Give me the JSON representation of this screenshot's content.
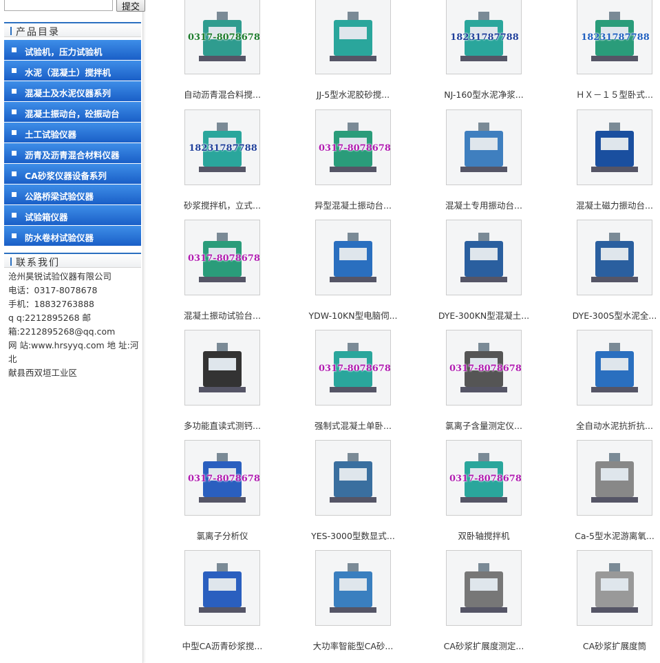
{
  "search": {
    "placeholder": "",
    "value": "",
    "submit_label": "提交"
  },
  "categories_title": "产品目录",
  "categories": [
    "试验机，压力试验机",
    "水泥（混凝土）搅拌机",
    "混凝土及水泥仪器系列",
    "混凝土振动台，砼振动台",
    "土工试验仪器",
    "沥青及沥青混合材料仪器",
    "CA砂浆仪器设备系列",
    "公路桥梁试验仪器",
    "试验箱仪器",
    "防水卷材试验仪器"
  ],
  "contact_title": "联系我们",
  "contact_lines": [
    "沧州昊锐试验仪器有限公司",
    "电话：0317-8078678",
    "手机：18832763888",
    "q q:2212895268 邮",
    "箱:2212895268@qq.com",
    "网 站:www.hrsyyq.com 地 址:河北",
    "献县西双垣工业区"
  ],
  "products": [
    {
      "caption": "自动沥青混合料搅...",
      "overlay": "0317-8078678",
      "overlay_color": "#1a7a2a",
      "accent": "#2f9c8f"
    },
    {
      "caption": "JJ-5型水泥胶砂搅...",
      "overlay": "",
      "overlay_color": "#1a7a2a",
      "accent": "#2aa69c"
    },
    {
      "caption": "NJ-160型水泥净浆...",
      "overlay": "18231787788",
      "overlay_color": "#1f3f9a",
      "accent": "#2aa69c"
    },
    {
      "caption": "ＨＸ－１５型卧式...",
      "overlay": "18231787788",
      "overlay_color": "#1f5fbf",
      "accent": "#2a9c7a"
    },
    {
      "caption": "砂浆搅拌机，立式...",
      "overlay": "18231787788",
      "overlay_color": "#1f3f9a",
      "accent": "#2aa69c"
    },
    {
      "caption": "异型混凝土振动台...",
      "overlay": "0317-8078678",
      "overlay_color": "#b01ab0",
      "accent": "#2a9c7a"
    },
    {
      "caption": "混凝土专用振动台...",
      "overlay": "",
      "overlay_color": "#1a7a2a",
      "accent": "#3f7fbf"
    },
    {
      "caption": "混凝土磁力振动台...",
      "overlay": "",
      "overlay_color": "#1a7a2a",
      "accent": "#1a4f9f"
    },
    {
      "caption": "混凝土振动试验台...",
      "overlay": "0317-8078678",
      "overlay_color": "#b01ab0",
      "accent": "#2a9c7a"
    },
    {
      "caption": "YDW-10KN型电脑伺...",
      "overlay": "",
      "overlay_color": "#1a7a2a",
      "accent": "#2a6fbf"
    },
    {
      "caption": "DYE-300KN型混凝土...",
      "overlay": "",
      "overlay_color": "#1a7a2a",
      "accent": "#2a5f9f"
    },
    {
      "caption": "DYE-300S型水泥全...",
      "overlay": "",
      "overlay_color": "#1a7a2a",
      "accent": "#2a5f9f"
    },
    {
      "caption": "多功能直读式测钙...",
      "overlay": "",
      "overlay_color": "#1a7a2a",
      "accent": "#333333"
    },
    {
      "caption": "强制式混凝土单卧...",
      "overlay": "0317-8078678",
      "overlay_color": "#b01ab0",
      "accent": "#2aa69c"
    },
    {
      "caption": "氯离子含量测定仪...",
      "overlay": "0317-8078678",
      "overlay_color": "#b01ab0",
      "accent": "#555555"
    },
    {
      "caption": "全自动水泥抗折抗...",
      "overlay": "",
      "overlay_color": "#1a7a2a",
      "accent": "#2a6fbf"
    },
    {
      "caption": "氯离子分析仪",
      "overlay": "0317-8078678",
      "overlay_color": "#b01ab0",
      "accent": "#2a5fbf"
    },
    {
      "caption": "YES-3000型数显式...",
      "overlay": "",
      "overlay_color": "#1a7a2a",
      "accent": "#3a6f9f"
    },
    {
      "caption": "双卧轴搅拌机",
      "overlay": "0317-8078678",
      "overlay_color": "#b01ab0",
      "accent": "#2aa69c"
    },
    {
      "caption": "Ca-5型水泥游离氧...",
      "overlay": "",
      "overlay_color": "#1a7a2a",
      "accent": "#888888"
    },
    {
      "caption": "中型CA沥青砂浆搅...",
      "overlay": "",
      "overlay_color": "#1a7a2a",
      "accent": "#2a5fbf"
    },
    {
      "caption": "大功率智能型CA砂...",
      "overlay": "",
      "overlay_color": "#1a7a2a",
      "accent": "#3a7fbf"
    },
    {
      "caption": "CA砂浆扩展度测定...",
      "overlay": "",
      "overlay_color": "#1a7a2a",
      "accent": "#777777"
    },
    {
      "caption": "CA砂浆扩展度筒",
      "overlay": "",
      "overlay_color": "#1a7a2a",
      "accent": "#999999"
    }
  ]
}
